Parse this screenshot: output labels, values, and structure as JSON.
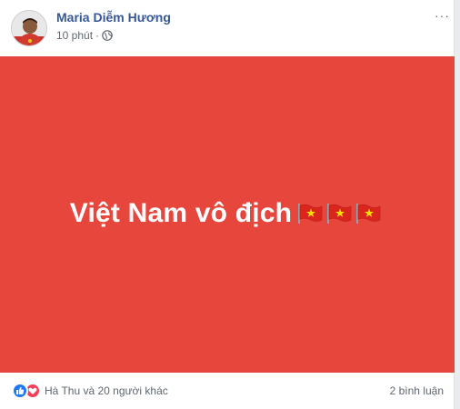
{
  "post": {
    "author": "Maria Diễm Hương",
    "time": "10 phút",
    "separator": "·",
    "privacy_icon": "globe-icon",
    "more_icon": "more-options-icon",
    "more_label": "···",
    "text": "Việt Nam vô địch",
    "background_color": "#e7463c",
    "flag_icons": [
      "vietnam-flag-icon",
      "vietnam-flag-icon",
      "vietnam-flag-icon"
    ]
  },
  "footer": {
    "reaction_icons": [
      "like-reaction-icon",
      "love-reaction-icon"
    ],
    "reaction_summary": "Hà Thu và 20 người khác",
    "comment_count": "2 bình luận"
  },
  "colors": {
    "author_link": "#365899",
    "meta_text": "#616770",
    "like_blue": "#2078f4",
    "love_red": "#f33e58"
  }
}
